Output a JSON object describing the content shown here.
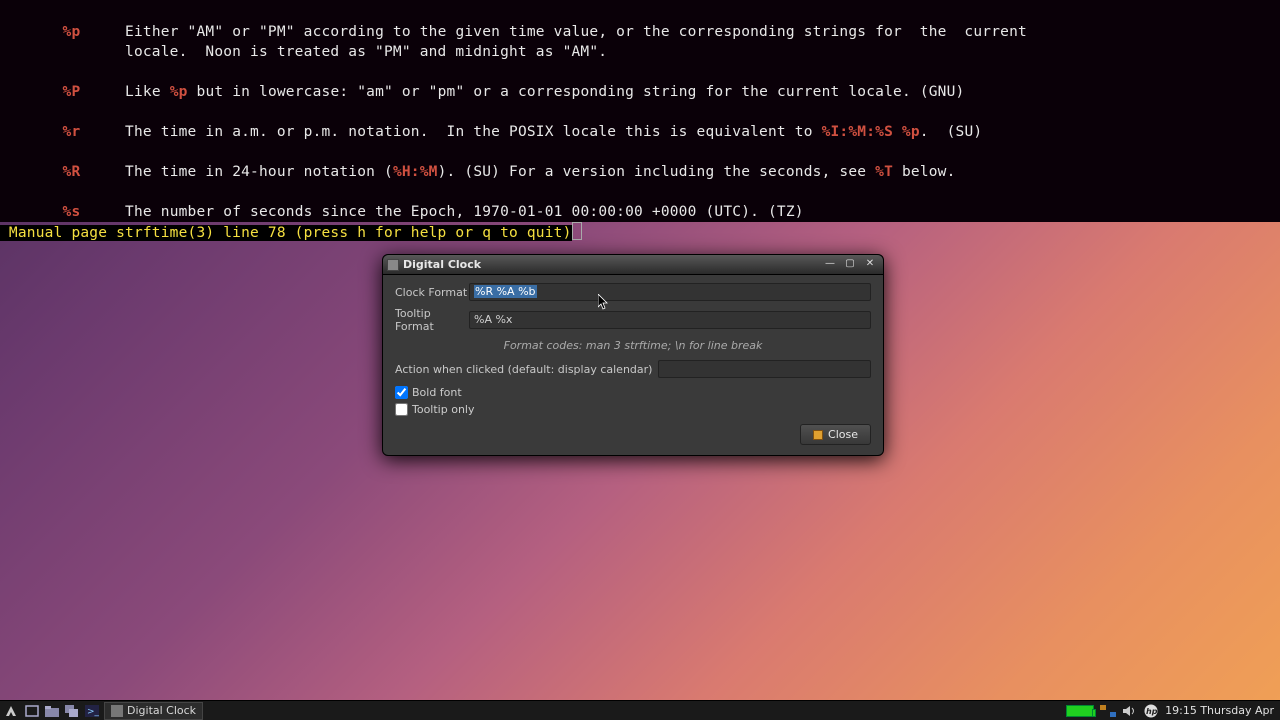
{
  "terminal": {
    "lines": [
      {
        "tok": "%p",
        "pad": "       ",
        "pre": "              ",
        "segments": [
          {
            "t": "Either \"AM\" or \"PM\" according to the given time value, or the corresponding strings for  the  current"
          }
        ]
      },
      {
        "cont": true,
        "pad": "              ",
        "segments": [
          {
            "t": "locale.  Noon is treated as \"PM\" and midnight as \"AM\"."
          }
        ]
      },
      {
        "blank": true
      },
      {
        "tok": "%P",
        "pad": "       ",
        "pre": "              ",
        "segments": [
          {
            "t": "Like "
          },
          {
            "tok": "%p"
          },
          {
            "t": " but in lowercase: \"am\" or \"pm\" or a corresponding string for the current locale. (GNU)"
          }
        ]
      },
      {
        "blank": true
      },
      {
        "tok": "%r",
        "pad": "       ",
        "pre": "              ",
        "segments": [
          {
            "t": "The time in a.m. or p.m. notation.  In the POSIX locale this is equivalent to "
          },
          {
            "tok": "%I:%M:%S %p"
          },
          {
            "t": ".  (SU)"
          }
        ]
      },
      {
        "blank": true
      },
      {
        "tok": "%R",
        "pad": "       ",
        "pre": "              ",
        "segments": [
          {
            "t": "The time in 24-hour notation ("
          },
          {
            "tok": "%H:%M"
          },
          {
            "t": "). (SU) For a version including the seconds, see "
          },
          {
            "tok": "%T"
          },
          {
            "t": " below."
          }
        ]
      },
      {
        "blank": true
      },
      {
        "tok": "%s",
        "pad": "       ",
        "pre": "              ",
        "segments": [
          {
            "t": "The number of seconds since the Epoch, 1970-01-01 00:00:00 +0000 (UTC). (TZ)"
          }
        ]
      }
    ],
    "status": " Manual page strftime(3) line 78 (press h for help or q to quit)"
  },
  "dialog": {
    "title": "Digital Clock",
    "clock_format_label": "Clock Format",
    "clock_format_value": "%R %A %b",
    "tooltip_format_label": "Tooltip Format",
    "tooltip_format_value": "%A %x",
    "hint": "Format codes: man 3 strftime; \\n for line break",
    "action_label": "Action when clicked (default: display calendar)",
    "action_value": "",
    "bold_font_label": "Bold font",
    "bold_font_checked": true,
    "tooltip_only_label": "Tooltip only",
    "tooltip_only_checked": false,
    "close_label": "Close"
  },
  "taskbar": {
    "task_label": "Digital Clock",
    "clock_text": "19:15 Thursday Apr"
  }
}
